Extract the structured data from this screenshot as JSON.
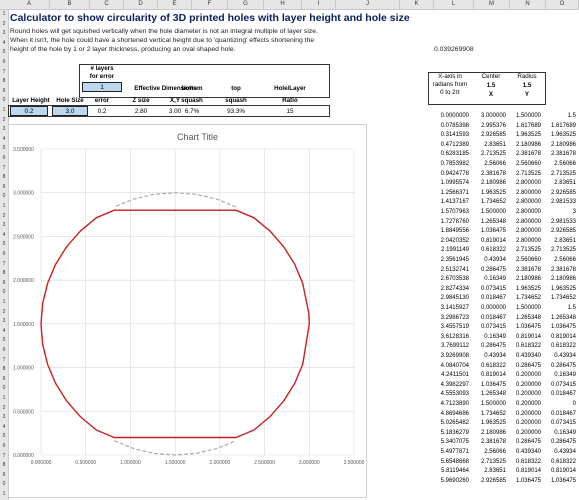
{
  "columns": [
    "A",
    "B",
    "C",
    "D",
    "E",
    "F",
    "G",
    "H",
    "I",
    "J",
    "K",
    "L",
    "M",
    "N",
    "O"
  ],
  "row_numbers": [
    "1",
    "2",
    "3",
    "4",
    "5",
    "6",
    "7",
    "8",
    "9",
    "0",
    "1",
    "2",
    "3",
    "4",
    "5",
    "6",
    "7",
    "8",
    "9",
    "0",
    "1",
    "2",
    "3",
    "4",
    "5",
    "6",
    "7",
    "8",
    "9",
    "0",
    "1",
    "2",
    "3",
    "4",
    "5",
    "6",
    "7",
    "8",
    "9",
    "0",
    "1",
    "2",
    "3",
    "4",
    "5",
    "6",
    "7",
    "8",
    "9",
    "0",
    "1"
  ],
  "title": "Calculator to show circularity of 3D printed holes with layer height and hole size",
  "notes": [
    "Round holes will get squished vertically when the hole diameter is not an integral multiple of layer size.",
    "When it isn't, the hole could have a shortened vertical height due to 'quantizing' effects shortening the",
    "height of the hole by 1 or 2 layer thickness, producing an oval shaped hole."
  ],
  "ratio_value": "0.039269908",
  "layers_label_1": "# layers",
  "layers_label_2": "for error",
  "layers_input": "1",
  "headers": {
    "layer_height": "Layer Height",
    "hole_size": "Hole Size",
    "error": "error",
    "effective": "Effective Dimensions",
    "z_size": "Z size",
    "xy": "X,Y",
    "bottom": "bottom",
    "bottom2": "squash",
    "top": "top",
    "top2": "squash",
    "ratio": "Hole/Layer",
    "ratio2": "Ratio"
  },
  "values": {
    "layer_height": "0.2",
    "hole_size": "3.0",
    "error": "0.2",
    "z_size": "2.80",
    "xy": "3.00",
    "bottom": "6.7%",
    "top": "93.3%",
    "ratio": "15"
  },
  "xaxis_label": [
    "X-axis in",
    "radians from",
    "0 to 2π"
  ],
  "center_label": "Center",
  "center_value": "1.5",
  "center_x": "X",
  "radius_label": "Radius",
  "radius_value": "1.5",
  "radius_y": "Y",
  "table_rows": [
    [
      "0.0000000",
      "3.000000",
      "1.500000",
      "1.5"
    ],
    [
      "0.0785398",
      "2.995376",
      "1.617689",
      "1.617689"
    ],
    [
      "0.3141593",
      "2.926585",
      "1.963525",
      "1.963525"
    ],
    [
      "0.4712389",
      "2.83651",
      "2.180986",
      "2.180986"
    ],
    [
      "0.6283185",
      "2.713525",
      "2.381678",
      "2.381678"
    ],
    [
      "0.7853982",
      "2.56066",
      "2.560660",
      "2.56066"
    ],
    [
      "0.9424778",
      "2.381678",
      "2.713525",
      "2.713525"
    ],
    [
      "1.0995574",
      "2.180986",
      "2.800000",
      "2.83651"
    ],
    [
      "1.2566371",
      "1.963525",
      "2.800000",
      "2.926585"
    ],
    [
      "1.4137167",
      "1.734652",
      "2.800000",
      "2.981533"
    ],
    [
      "1.5707963",
      "1.500000",
      "2.800000",
      "3"
    ],
    [
      "1.7278760",
      "1.265348",
      "2.800000",
      "2.981533"
    ],
    [
      "1.8849556",
      "1.036475",
      "2.800000",
      "2.926585"
    ],
    [
      "2.0420352",
      "0.819014",
      "2.800000",
      "2.83651"
    ],
    [
      "2.1991149",
      "0.618322",
      "2.713525",
      "2.713525"
    ],
    [
      "2.3561945",
      "0.43934",
      "2.560660",
      "2.56066"
    ],
    [
      "2.5132741",
      "0.286475",
      "2.381678",
      "2.381678"
    ],
    [
      "2.6703538",
      "0.16349",
      "2.180986",
      "2.180986"
    ],
    [
      "2.8274334",
      "0.073415",
      "1.963525",
      "1.963525"
    ],
    [
      "2.9845130",
      "0.018467",
      "1.734652",
      "1.734652"
    ],
    [
      "3.1415927",
      "0.000000",
      "1.500000",
      "1.5"
    ],
    [
      "3.2986723",
      "0.018467",
      "1.265348",
      "1.265348"
    ],
    [
      "3.4557519",
      "0.073415",
      "1.036475",
      "1.036475"
    ],
    [
      "3.6128316",
      "0.16349",
      "0.819014",
      "0.819014"
    ],
    [
      "3.7699112",
      "0.286475",
      "0.618322",
      "0.618322"
    ],
    [
      "3.9269908",
      "0.43934",
      "0.439340",
      "0.43934"
    ],
    [
      "4.0840704",
      "0.618322",
      "0.286475",
      "0.286475"
    ],
    [
      "4.2411501",
      "0.819014",
      "0.200000",
      "0.16349"
    ],
    [
      "4.3982297",
      "1.036475",
      "0.200000",
      "0.073415"
    ],
    [
      "4.5553093",
      "1.265348",
      "0.200000",
      "0.018467"
    ],
    [
      "4.7123890",
      "1.500000",
      "0.200000",
      "0"
    ],
    [
      "4.8694686",
      "1.734652",
      "0.200000",
      "0.018467"
    ],
    [
      "5.0265482",
      "1.963525",
      "0.200000",
      "0.073415"
    ],
    [
      "5.1836279",
      "2.180986",
      "0.200000",
      "0.16349"
    ],
    [
      "5.3407075",
      "2.381678",
      "0.286475",
      "0.286475"
    ],
    [
      "5.4977871",
      "2.56066",
      "0.439340",
      "0.43934"
    ],
    [
      "5.6548668",
      "2.713525",
      "0.618322",
      "0.618322"
    ],
    [
      "5.8119464",
      "2.83651",
      "0.819014",
      "0.819014"
    ],
    [
      "5.9690260",
      "2.926585",
      "1.036475",
      "1.036475"
    ]
  ],
  "chart_data": {
    "type": "scatter",
    "title": "Chart Title",
    "xlim": [
      0,
      3.5
    ],
    "ylim": [
      0,
      3.5
    ],
    "x_ticks": [
      "0.000000",
      "0.500000",
      "1.000000",
      "1.500000",
      "2.000000",
      "2.500000",
      "3.000000",
      "3.500000"
    ],
    "y_ticks": [
      "0.000000",
      "0.500000",
      "1.000000",
      "1.500000",
      "2.000000",
      "2.500000",
      "3.000000",
      "3.500000"
    ],
    "grid": true,
    "series": [
      {
        "color": "#cc1f1f",
        "style": "solid",
        "points": [
          [
            3.0,
            1.5
          ],
          [
            2.995376,
            1.617689
          ],
          [
            2.926585,
            1.963525
          ],
          [
            2.83651,
            2.180986
          ],
          [
            2.713525,
            2.381678
          ],
          [
            2.56066,
            2.56066
          ],
          [
            2.381678,
            2.713525
          ],
          [
            2.180986,
            2.8
          ],
          [
            1.963525,
            2.8
          ],
          [
            1.734652,
            2.8
          ],
          [
            1.5,
            2.8
          ],
          [
            1.265348,
            2.8
          ],
          [
            1.036475,
            2.8
          ],
          [
            0.819014,
            2.8
          ],
          [
            0.618322,
            2.713525
          ],
          [
            0.43934,
            2.56066
          ],
          [
            0.286475,
            2.381678
          ],
          [
            0.16349,
            2.180986
          ],
          [
            0.073415,
            1.963525
          ],
          [
            0.018467,
            1.734652
          ],
          [
            0.0,
            1.5
          ],
          [
            0.018467,
            1.265348
          ],
          [
            0.073415,
            1.036475
          ],
          [
            0.16349,
            0.819014
          ],
          [
            0.286475,
            0.618322
          ],
          [
            0.43934,
            0.43934
          ],
          [
            0.618322,
            0.286475
          ],
          [
            0.819014,
            0.2
          ],
          [
            1.036475,
            0.2
          ],
          [
            1.265348,
            0.2
          ],
          [
            1.5,
            0.2
          ],
          [
            1.734652,
            0.2
          ],
          [
            1.963525,
            0.2
          ],
          [
            2.180986,
            0.2
          ],
          [
            2.381678,
            0.286475
          ],
          [
            2.56066,
            0.43934
          ],
          [
            2.713525,
            0.618322
          ],
          [
            2.83651,
            0.819014
          ],
          [
            2.926585,
            1.036475
          ],
          [
            3.0,
            1.5
          ]
        ]
      },
      {
        "color": "#aaaaaa",
        "style": "dashed",
        "points": [
          [
            2.180986,
            2.83651
          ],
          [
            1.963525,
            2.926585
          ],
          [
            1.734652,
            2.981533
          ],
          [
            1.5,
            3.0
          ],
          [
            1.265348,
            2.981533
          ],
          [
            1.036475,
            2.926585
          ],
          [
            0.819014,
            2.83651
          ],
          [
            0.819014,
            0.16349
          ],
          [
            1.036475,
            0.073415
          ],
          [
            1.265348,
            0.018467
          ],
          [
            1.5,
            0.0
          ],
          [
            1.734652,
            0.018467
          ],
          [
            1.963525,
            0.073415
          ],
          [
            2.180986,
            0.16349
          ]
        ]
      }
    ]
  }
}
